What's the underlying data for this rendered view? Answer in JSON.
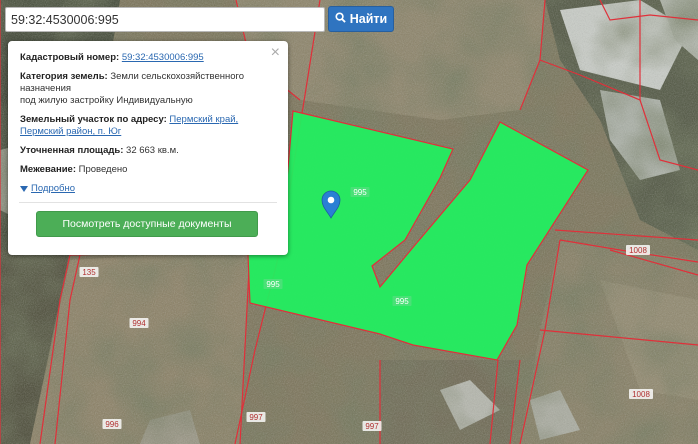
{
  "search": {
    "value": "59:32:4530006:995",
    "button_label": "Найти"
  },
  "popup": {
    "cadastral_label": "Кадастровый номер:",
    "cadastral_value": "59:32:4530006:995",
    "category_label": "Категория земель:",
    "category_value_line1": "Земли сельскохозяйственного",
    "category_value_line2": "назначения",
    "category_value_line3": "под жилую застройку Индивидуальную",
    "address_label": "Земельный участок по адресу:",
    "address_value_line1": "Пермский край,",
    "address_value_line2": "Пермский район, п. Юг",
    "area_label": "Уточненная площадь:",
    "area_value": "32 663 кв.м.",
    "survey_label": "Межевание:",
    "survey_value": "Проведено",
    "more_link": "Подробно",
    "docs_button": "Посмотреть доступные документы",
    "close_symbol": "×"
  },
  "map": {
    "parcel_labels": [
      {
        "text": "995"
      },
      {
        "text": "995"
      },
      {
        "text": "995"
      },
      {
        "text": "135"
      },
      {
        "text": "994"
      },
      {
        "text": "996"
      },
      {
        "text": "997"
      },
      {
        "text": "997"
      },
      {
        "text": "1008"
      },
      {
        "text": "1008"
      }
    ],
    "highlight_color": "#20f060",
    "boundary_color": "#e0303a"
  },
  "icons": {
    "search": "magnifier-icon",
    "marker": "map-marker-icon",
    "close": "close-icon",
    "expand": "triangle-down-icon"
  }
}
